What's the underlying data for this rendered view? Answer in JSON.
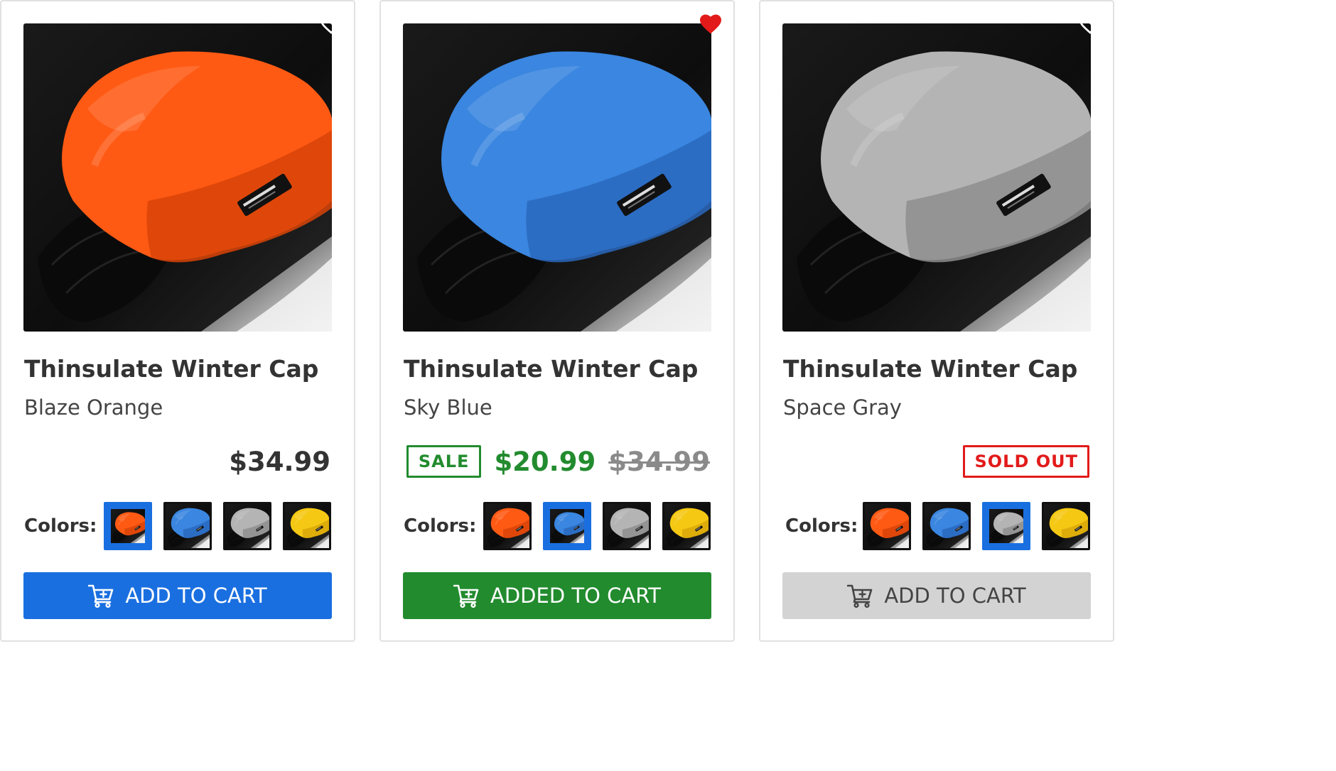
{
  "products": [
    {
      "title": "Thinsulate Winter Cap",
      "variant": "Blaze Orange",
      "cap_color": "#ff5a14",
      "cap_shade": "#d94408",
      "favorited": false,
      "price": "$34.99",
      "colors_label": "Colors:",
      "button_label": "ADD TO CART",
      "button_color": "#1a6fe0"
    },
    {
      "title": "Thinsulate Winter Cap",
      "variant": "Sky Blue",
      "cap_color": "#3a86e0",
      "cap_shade": "#2a68be",
      "favorited": true,
      "sale_badge": "SALE",
      "sale_price": "$20.99",
      "original_price": "$34.99",
      "colors_label": "Colors:",
      "button_label": "ADDED TO CART",
      "button_color": "#228b2e"
    },
    {
      "title": "Thinsulate Winter Cap",
      "variant": "Space Gray",
      "cap_color": "#b4b4b4",
      "cap_shade": "#8e8e8e",
      "favorited": false,
      "sold_out_badge": "SOLD OUT",
      "colors_label": "Colors:",
      "button_label": "ADD TO CART",
      "button_color": "#d3d3d3"
    }
  ],
  "color_options": [
    {
      "name": "Blaze Orange",
      "color": "#ff5a14",
      "shade": "#d94408"
    },
    {
      "name": "Sky Blue",
      "color": "#3a86e0",
      "shade": "#2a68be"
    },
    {
      "name": "Space Gray",
      "color": "#b4b4b4",
      "shade": "#8e8e8e"
    },
    {
      "name": "Yellow",
      "color": "#f5c814",
      "shade": "#d9a808"
    }
  ],
  "selected_color_index": [
    0,
    1,
    2
  ],
  "colors": {
    "accent_blue": "#1a6fe0",
    "success_green": "#228b2e",
    "sold_out_red": "#e21a1a",
    "heart_red": "#e21a1a"
  },
  "icons": {
    "favorite": "heart-icon",
    "cart": "cart-icon"
  }
}
